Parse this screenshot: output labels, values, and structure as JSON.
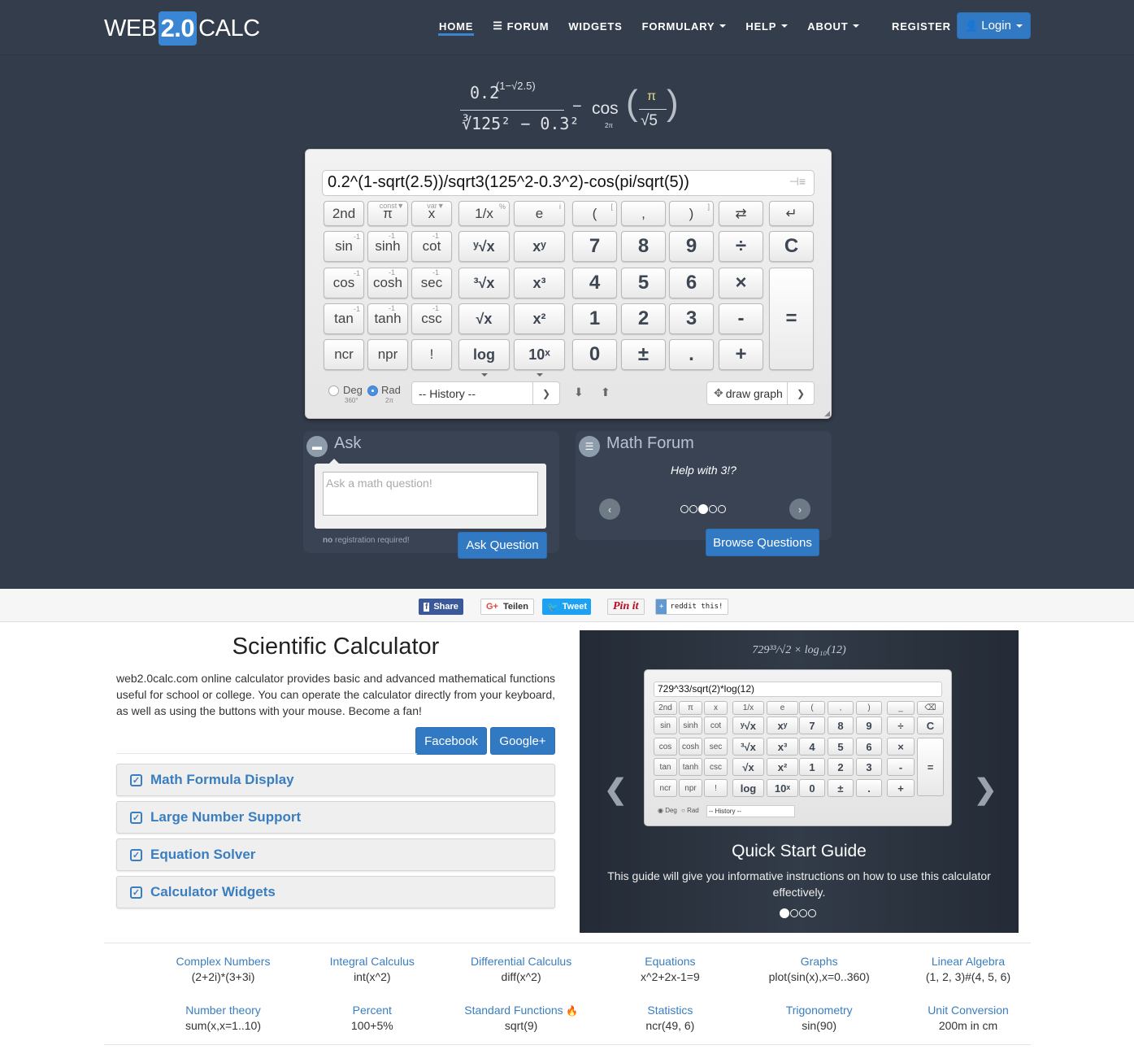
{
  "nav": {
    "logo_left": "WEB",
    "logo_mid": "2.0",
    "logo_right": "CALC",
    "items": [
      {
        "label": "HOME",
        "active": true
      },
      {
        "label": "FORUM",
        "icon": "list-icon"
      },
      {
        "label": "WIDGETS"
      },
      {
        "label": "FORMULARY",
        "dropdown": true
      },
      {
        "label": "HELP",
        "dropdown": true
      },
      {
        "label": "ABOUT",
        "dropdown": true
      }
    ],
    "register": "REGISTER",
    "login": "Login",
    "accent": "#3a86d4"
  },
  "formula": {
    "numerator": "0.2",
    "exponent": "(1−√2.5)",
    "denominator": "∛125² − 0.3²",
    "minus": "−",
    "func": "cos",
    "func_sub": "2π",
    "pi": "π",
    "sqrt5": "√5"
  },
  "calculator": {
    "input_value": "0.2^(1-sqrt(2.5))/sqrt3(125^2-0.3^2)-cos(pi/sqrt(5))",
    "keys_row0": [
      "2nd",
      "π",
      "x",
      "1/x",
      "e",
      "(",
      ",",
      ")",
      "⇄",
      "↵"
    ],
    "keys_row0_corner": [
      "",
      "const▼",
      "var▼",
      "%",
      "i",
      "[",
      "",
      "]",
      "",
      ""
    ],
    "keys_row1": [
      "sin",
      "sinh",
      "cot",
      "ʸ√x",
      "xʸ",
      "7",
      "8",
      "9",
      "÷",
      "C"
    ],
    "keys_row2": [
      "cos",
      "cosh",
      "sec",
      "³√x",
      "x³",
      "4",
      "5",
      "6",
      "×"
    ],
    "keys_row3": [
      "tan",
      "tanh",
      "csc",
      "√x",
      "x²",
      "1",
      "2",
      "3",
      "-"
    ],
    "keys_row4": [
      "ncr",
      "npr",
      "!",
      "log",
      "10ˣ",
      "0",
      "±",
      ".",
      "+"
    ],
    "equals": "=",
    "inverse_mark": "-1",
    "angle": {
      "deg_label": "Deg",
      "deg_sub": "360°",
      "rad_label": "Rad",
      "rad_sub": "2π",
      "selected": "Rad"
    },
    "history_placeholder": "-- History --",
    "draw_graph": "draw graph"
  },
  "ask": {
    "title": "Ask",
    "placeholder": "Ask a math question!",
    "note_bold": "no",
    "note": "registration required!",
    "button": "Ask Question"
  },
  "forum": {
    "title": "Math Forum",
    "question": "Help with 3!?",
    "dots_total": 5,
    "dots_active": 3,
    "button": "Browse Questions"
  },
  "share": {
    "facebook": "Share",
    "google": "Teilen",
    "twitter": "Tweet",
    "pinterest": "Pin it",
    "reddit": "reddit this!"
  },
  "intro": {
    "title": "Scientific Calculator",
    "description": "web2.0calc.com online calculator provides basic and advanced mathematical functions useful for school or college. You can operate the calculator directly from your keyboard, as well as using the buttons with your mouse. Become a fan!",
    "facebook": "Facebook",
    "google": "Google+"
  },
  "features": [
    "Math Formula Display",
    "Large Number Support",
    "Equation Solver",
    "Calculator Widgets"
  ],
  "guide": {
    "formula": "729³³/√2 × log₁₀(12)",
    "mini_input": "729^33/sqrt(2)*log(12)",
    "mini_rows": [
      [
        "2nd",
        "π",
        "x",
        "1/x",
        "e",
        "(",
        ",",
        ")",
        "_",
        "⌫"
      ],
      [
        "sin",
        "sinh",
        "cot",
        "ʸ√x",
        "xʸ",
        "7",
        "8",
        "9",
        "÷",
        "C"
      ],
      [
        "cos",
        "cosh",
        "sec",
        "³√x",
        "x³",
        "4",
        "5",
        "6",
        "×"
      ],
      [
        "tan",
        "tanh",
        "csc",
        "√x",
        "x²",
        "1",
        "2",
        "3",
        "-"
      ],
      [
        "ncr",
        "npr",
        "!",
        "log",
        "10ˣ",
        "0",
        "±",
        ".",
        "+"
      ]
    ],
    "mini_deg": "Deg",
    "mini_rad": "Rad",
    "mini_history": "-- History --",
    "title": "Quick Start Guide",
    "text": "This guide will give you informative instructions on how to use this calculator effectively.",
    "dots_total": 4,
    "dots_active": 1
  },
  "examples": [
    {
      "title": "Complex Numbers",
      "expr": "(2+2i)*(3+3i)"
    },
    {
      "title": "Integral Calculus",
      "expr": "int(x^2)"
    },
    {
      "title": "Differential Calculus",
      "expr": "diff(x^2)"
    },
    {
      "title": "Equations",
      "expr": "x^2+2x-1=9"
    },
    {
      "title": "Graphs",
      "expr": "plot(sin(x),x=0..360)"
    },
    {
      "title": "Linear Algebra",
      "expr": "(1, 2, 3)#(4, 5, 6)"
    },
    {
      "title": "Number theory",
      "expr": "sum(x,x=1..10)"
    },
    {
      "title": "Percent",
      "expr": "100+5%"
    },
    {
      "title": "Standard Functions",
      "expr": "sqrt(9)",
      "icon": "fire-icon"
    },
    {
      "title": "Statistics",
      "expr": "ncr(49, 6)"
    },
    {
      "title": "Trigonometry",
      "expr": "sin(90)"
    },
    {
      "title": "Unit Conversion",
      "expr": "200m in cm"
    }
  ]
}
